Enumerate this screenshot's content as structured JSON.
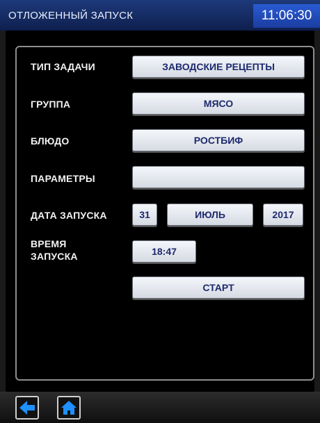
{
  "header": {
    "title": "ОТЛОЖЕННЫЙ ЗАПУСК",
    "time": "11:06:30"
  },
  "form": {
    "task_type": {
      "label": "ТИП ЗАДАЧИ",
      "value": "ЗАВОДСКИЕ РЕЦЕПТЫ"
    },
    "group": {
      "label": "ГРУППА",
      "value": "МЯСО"
    },
    "dish": {
      "label": "БЛЮДО",
      "value": "РОСТБИФ"
    },
    "parameters": {
      "label": "ПАРАМЕТРЫ",
      "value": ""
    },
    "start_date": {
      "label": "ДАТА ЗАПУСКА",
      "day": "31",
      "month": "ИЮЛЬ",
      "year": "2017"
    },
    "start_time": {
      "label_line1": "ВРЕМЯ",
      "label_line2": "ЗАПУСКА",
      "value": "18:47"
    },
    "start_button": "СТАРТ"
  },
  "navigation": {
    "back_icon": "arrow-left-icon",
    "home_icon": "home-icon",
    "accent": "#1e90ff"
  }
}
